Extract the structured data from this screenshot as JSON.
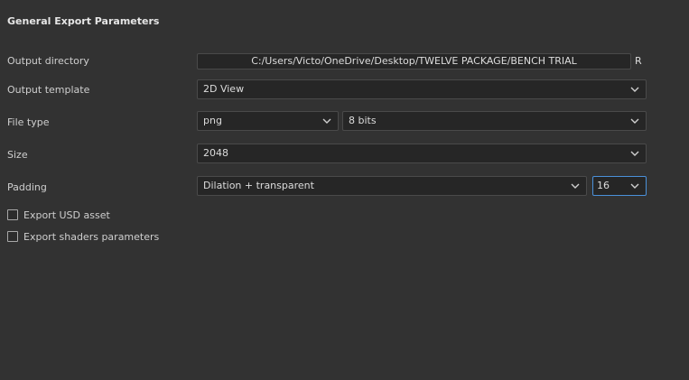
{
  "section": {
    "title": "General Export Parameters"
  },
  "output_directory": {
    "label": "Output directory",
    "value": "C:/Users/Victo/OneDrive/Desktop/TWELVE PACKAGE/BENCH TRIAL",
    "reset_label": "R"
  },
  "output_template": {
    "label": "Output template",
    "selected": "2D View"
  },
  "file_type": {
    "label": "File type",
    "format_selected": "png",
    "bitdepth_selected": "8 bits"
  },
  "size": {
    "label": "Size",
    "selected": "2048"
  },
  "padding": {
    "label": "Padding",
    "mode_selected": "Dilation + transparent",
    "amount_selected": "16"
  },
  "options": {
    "export_usd_label": "Export USD asset",
    "export_usd_checked": false,
    "export_shaders_label": "Export shaders parameters",
    "export_shaders_checked": false
  },
  "colors": {
    "background": "#323232",
    "field_bg": "#262626",
    "field_border": "#4a4a4a",
    "focus_border": "#4a90d9"
  },
  "icons": {
    "dropdown": "chevron-down-icon",
    "checkbox": "checkbox-unchecked-icon"
  }
}
